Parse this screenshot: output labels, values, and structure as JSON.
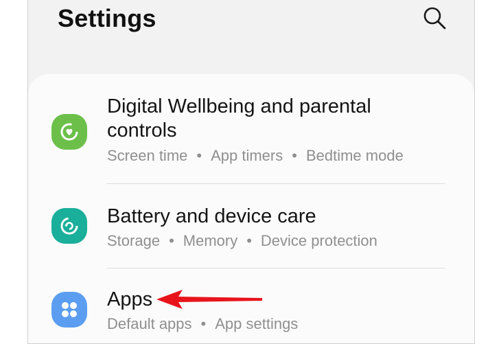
{
  "header": {
    "title": "Settings",
    "search_icon": "search-icon"
  },
  "colors": {
    "wellbeing_icon_bg": "#6cc04a",
    "battery_icon_bg": "#1aaf9a",
    "apps_icon_bg": "#5b9df0",
    "annotation_arrow": "#e8141b"
  },
  "settings_items": [
    {
      "title": "Digital Wellbeing and parental controls",
      "icon": "wellbeing-icon",
      "subtitle": [
        "Screen time",
        "App timers",
        "Bedtime mode"
      ]
    },
    {
      "title": "Battery and device care",
      "icon": "device-care-icon",
      "subtitle": [
        "Storage",
        "Memory",
        "Device protection"
      ]
    },
    {
      "title": "Apps",
      "icon": "apps-grid-icon",
      "subtitle": [
        "Default apps",
        "App settings"
      ]
    }
  ],
  "separator": "•"
}
